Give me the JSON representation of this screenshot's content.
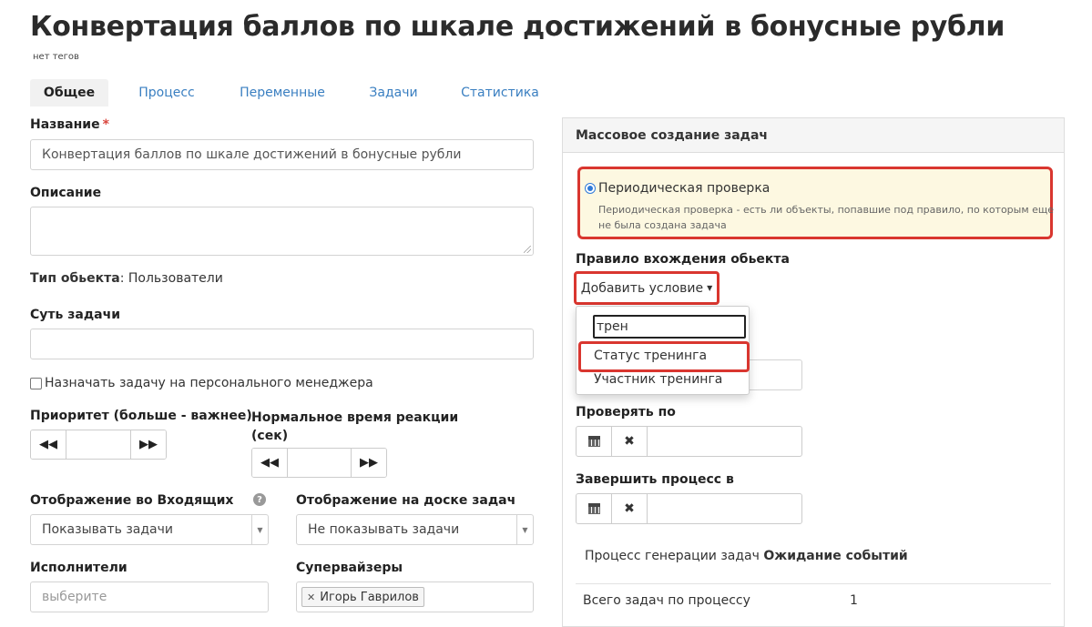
{
  "page": {
    "title": "Конвертация баллов по шкале достижений в бонусные рубли",
    "tags": "нет тегов"
  },
  "tabs": [
    {
      "label": "Общее",
      "active": true
    },
    {
      "label": "Процесс",
      "active": false
    },
    {
      "label": "Переменные",
      "active": false
    },
    {
      "label": "Задачи",
      "active": false
    },
    {
      "label": "Статистика",
      "active": false
    }
  ],
  "form": {
    "name_label": "Название",
    "name_required_mark": "*",
    "name_value": "Конвертация баллов по шкале достижений в бонусные рубли",
    "description_label": "Описание",
    "description_value": "",
    "object_type_label": "Тип обьекта",
    "object_type_value": ": Пользователи",
    "essence_label": "Суть задачи",
    "essence_value": "",
    "assign_manager_label": "Назначать задачу на персонального менеджера",
    "assign_manager_checked": false,
    "priority_label": "Приоритет (больше - важнее)",
    "priority_value": "",
    "reaction_label_line1": "Нормальное время реакции",
    "reaction_label_line2": "(сек)",
    "reaction_value": "",
    "inbox_display_label": "Отображение во Входящих",
    "inbox_display_value": "Показывать задачи",
    "board_display_label": "Отображение на доске задач",
    "board_display_value": "Не показывать задачи",
    "executors_label": "Исполнители",
    "executors_placeholder": "выберите",
    "supervisors_label": "Супервайзеры",
    "supervisors": [
      "Игорь Гаврилов"
    ]
  },
  "mass_panel": {
    "header": "Массовое создание задач",
    "periodic_label": "Периодическая проверка",
    "periodic_selected": true,
    "periodic_desc_line1": "Периодическая проверка - есть ли объекты, попавшие под правило, по которым еще",
    "periodic_desc_line2": "не была создана задача",
    "rule_label": "Правило вхождения обьекта",
    "add_condition_label": "Добавить условие",
    "dropdown_search_value": "трен",
    "dropdown_items": [
      "Статус тренинга",
      "Участник тренинга"
    ],
    "check_by_label": "Проверять по",
    "check_by_value": "",
    "finish_label": "Завершить процесс в",
    "finish_value": "",
    "gen_process_label": "Процесс генерации задач",
    "gen_process_value": "Ожидание событий",
    "total_tasks_label": "Всего задач по процессу",
    "total_tasks_value": "1"
  },
  "icons": {
    "step_back": "fast-backward-icon",
    "step_forward": "fast-forward-icon",
    "calendar": "calendar-icon",
    "clear": "close-icon",
    "help": "question-circle-icon",
    "caret": "caret-down-icon"
  },
  "colors": {
    "accent_link": "#3a7fc1",
    "highlight_red": "#d9362f",
    "notice_bg": "#fdf8e1",
    "required_red": "#d9453d"
  }
}
